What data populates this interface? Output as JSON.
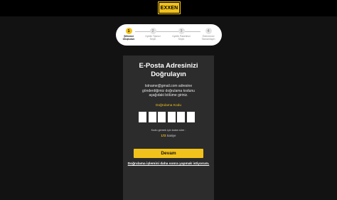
{
  "header": {
    "logo_text": "EXXEN"
  },
  "stepper": {
    "steps": [
      {
        "number": "1",
        "label": "Şifrenizi\nOluşturun",
        "active": true
      },
      {
        "number": "2",
        "label": "Üyelik Tipinizi\nSeçin",
        "active": false
      },
      {
        "number": "3",
        "label": "Üyelik Paketinizi\nSeçin",
        "active": false
      },
      {
        "number": "4",
        "label": "Ödemenizi\nTamamlayın",
        "active": false
      }
    ]
  },
  "verify": {
    "title": "E-Posta Adresinizi\nDoğrulayın",
    "description": "tstname@gmail.com adresine\ngönderdiğimiz doğrulama kodunu\naşağıdaki bölüme giriniz.",
    "code_label": "Doğrulama Kodu",
    "code_values": [
      "",
      "",
      "",
      "",
      "",
      ""
    ],
    "timer_text": "Kodu girmek için kalan süre :",
    "timer_seconds": "172",
    "timer_unit": "Saniye",
    "continue_label": "Devam",
    "later_link": "Doğrulama işlemini daha sonra yapmak istiyorum."
  },
  "colors": {
    "accent": "#f2c21c",
    "background": "#121212",
    "card": "#2c2c2c"
  }
}
